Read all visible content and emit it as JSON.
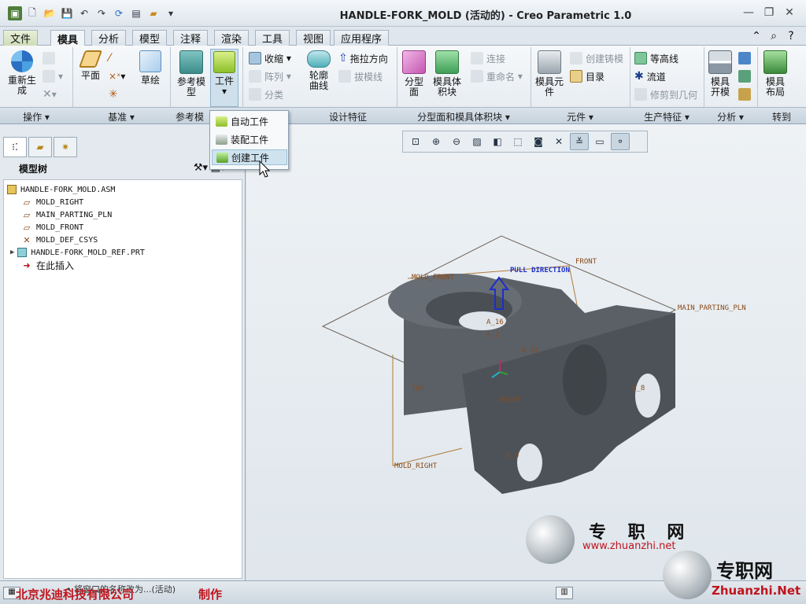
{
  "window": {
    "title": "HANDLE-FORK_MOLD (活动的) - Creo Parametric 1.0",
    "controls": [
      "—",
      "❐",
      "✕"
    ]
  },
  "quick_access": [
    "app-icon",
    "new-icon",
    "open-icon",
    "save-icon",
    "undo-icon",
    "redo-icon",
    "regenerate-icon",
    "windows-icon",
    "close-icon",
    "customize-icon"
  ],
  "tabs": [
    {
      "label": "文件"
    },
    {
      "label": "模具"
    },
    {
      "label": "分析"
    },
    {
      "label": "模型"
    },
    {
      "label": "注释"
    },
    {
      "label": "渲染"
    },
    {
      "label": "工具"
    },
    {
      "label": "视图"
    },
    {
      "label": "应用程序"
    }
  ],
  "ribbon": {
    "operations": {
      "regenerate": "重新生\n成",
      "label": "操作"
    },
    "datum": {
      "plane": "平面",
      "sketch": "草绘",
      "label": "基准"
    },
    "reference": {
      "ref_model": "参考模\n型",
      "workpiece": "工件",
      "label": "参考模"
    },
    "design": {
      "shrink": "收缩",
      "array": "阵列",
      "classify": "分类",
      "silhouette": "轮廓\n曲线",
      "pull_dir": "拖拉方向",
      "draft": "拔模线",
      "label": "设计特征"
    },
    "parting": {
      "parting_surface": "分型\n面",
      "mold_volume": "模具体\n积块",
      "connect": "连接",
      "rename": "重命名",
      "label": "分型面和模具体积块"
    },
    "component": {
      "mold_component": "模具元\n件",
      "create_casting": "创建铸模",
      "catalog": "目录",
      "label": "元件"
    },
    "production": {
      "contour": "等高线",
      "runner": "流道",
      "trim": "修剪到几何",
      "label": "生产特征"
    },
    "analysis": {
      "mold_open": "模具\n开模",
      "label": "分析"
    },
    "goto": {
      "mold_layout": "模具\n布局",
      "label": "转到"
    }
  },
  "workpiece_menu": {
    "items": [
      "自动工件",
      "装配工件",
      "创建工件"
    ],
    "highlighted": 2
  },
  "model_tree": {
    "title": "模型树",
    "nodes": [
      {
        "label": "HANDLE-FORK_MOLD.ASM",
        "icon": "assembly-icon"
      },
      {
        "label": "MOLD_RIGHT",
        "icon": "datum-plane-icon"
      },
      {
        "label": "MAIN_PARTING_PLN",
        "icon": "datum-plane-icon"
      },
      {
        "label": "MOLD_FRONT",
        "icon": "datum-plane-icon"
      },
      {
        "label": "MOLD_DEF_CSYS",
        "icon": "csys-icon"
      },
      {
        "label": "HANDLE-FORK_MOLD_REF.PRT",
        "icon": "part-icon"
      },
      {
        "label": "在此插入",
        "icon": "insert-here-icon"
      }
    ]
  },
  "view_toolbar": [
    "refit-icon",
    "zoom-in-icon",
    "zoom-out-icon",
    "repaint-icon",
    "display-style-icon",
    "saved-views-icon",
    "view-manager-icon",
    "datum-display-icon",
    "annotation-icon",
    "spin-center-icon",
    "layers-icon",
    "csys-display-icon"
  ],
  "model_labels": {
    "front": "FRONT",
    "pull_direction": "PULL DIRECTION",
    "mold_front": "MOLD_FRONT",
    "parting_pln": "MAIN_PARTING_PLN",
    "mold_right": "MOLD_RIGHT",
    "top": "TOP",
    "right": "RIGHT",
    "a16": "A_16",
    "a2": "A_2",
    "a15": "A_15",
    "a8": "A_8",
    "a9": "A_9"
  },
  "watermark": {
    "cn": "专 职 网",
    "url": "www.zhuanzhi.net",
    "cn2": "专职网",
    "brand": "Zhuanzhi.Net"
  },
  "status": {
    "message": "• 将窗口的名称改为...(活动)",
    "company": "北京兆迪科技有限公司",
    "made_by": "制作"
  },
  "colors": {
    "accent": "#c0141d",
    "model": "#5a6168",
    "datum": "#8a4a1a"
  }
}
